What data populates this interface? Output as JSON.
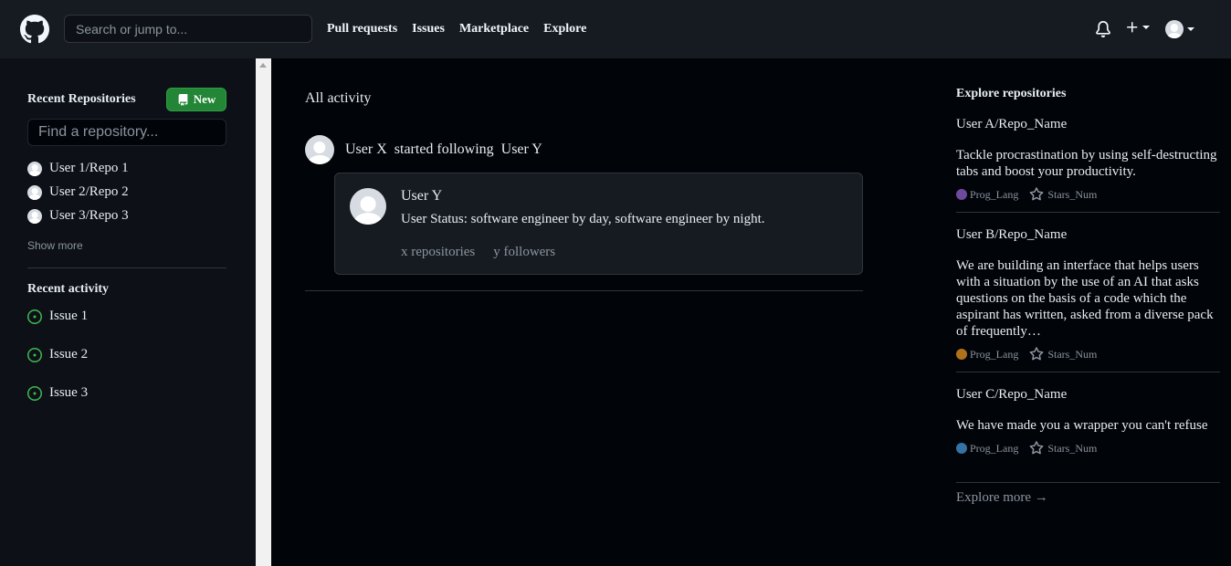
{
  "header": {
    "search_placeholder": "Search or jump to...",
    "nav": [
      "Pull requests",
      "Issues",
      "Marketplace",
      "Explore"
    ]
  },
  "sidebar": {
    "recent_repos_title": "Recent Repositories",
    "new_button": "New",
    "find_repo_placeholder": "Find a repository...",
    "repos": [
      "User 1/Repo 1",
      "User 2/Repo 2",
      "User 3/Repo 3"
    ],
    "show_more": "Show more",
    "recent_activity_title": "Recent activity",
    "issues": [
      "Issue 1",
      "Issue 2",
      "Issue 3"
    ]
  },
  "feed": {
    "title": "All activity",
    "actor": "User X",
    "action": "started following",
    "target": "User Y",
    "card": {
      "name": "User Y",
      "status": "User Status: software engineer by day, software engineer by night.",
      "repositories": "x repositories",
      "followers": "y followers"
    }
  },
  "explore": {
    "title": "Explore repositories",
    "repos": [
      {
        "name": "User A/Repo_Name",
        "description": "Tackle procrastination by using self-destructing tabs and boost your productivity.",
        "language": "Prog_Lang",
        "lang_color": "#6e4a9e",
        "stars": "Stars_Num"
      },
      {
        "name": "User B/Repo_Name",
        "description": "We are building an interface that helps users with a situation by the use of an AI that asks questions on the basis of a code which the aspirant has written, asked from a diverse pack of frequently…",
        "language": "Prog_Lang",
        "lang_color": "#b07219",
        "stars": "Stars_Num"
      },
      {
        "name": "User C/Repo_Name",
        "description": "We have made you a wrapper you can't refuse",
        "language": "Prog_Lang",
        "lang_color": "#3572a5",
        "stars": "Stars_Num"
      }
    ],
    "explore_more": "Explore more →"
  }
}
